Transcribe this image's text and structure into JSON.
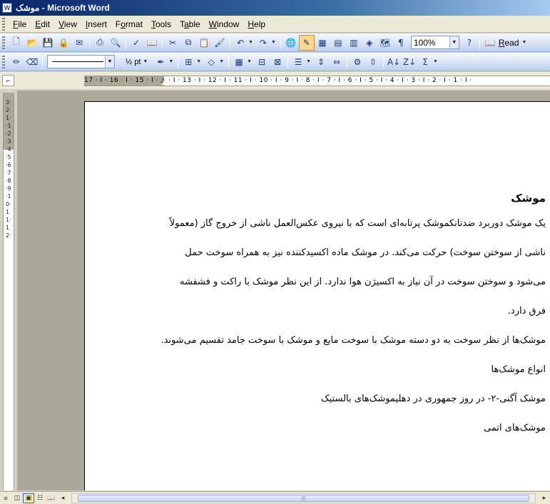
{
  "window": {
    "title": "موشک - Microsoft Word",
    "icon": "word-document-icon"
  },
  "menu": [
    {
      "id": "file",
      "label": "File",
      "underline": "F"
    },
    {
      "id": "edit",
      "label": "Edit",
      "underline": "E"
    },
    {
      "id": "view",
      "label": "View",
      "underline": "V"
    },
    {
      "id": "insert",
      "label": "Insert",
      "underline": "I"
    },
    {
      "id": "format",
      "label": "Format",
      "underline": "o"
    },
    {
      "id": "tools",
      "label": "Tools",
      "underline": "T"
    },
    {
      "id": "table",
      "label": "Table",
      "underline": "a"
    },
    {
      "id": "window",
      "label": "Window",
      "underline": "W"
    },
    {
      "id": "help",
      "label": "Help",
      "underline": "H"
    }
  ],
  "toolbar_standard": {
    "zoom": "100%",
    "read_label": "Read",
    "read_underline": "R"
  },
  "toolbar_drawing": {
    "line_weight": "½ pt"
  },
  "ruler": {
    "horizontal_numbers": "17 · I · 16 · I · 15 · I · △ · I · 13 · I · 12 · I · 11 · I · 10 · I · 9 · I · 8 · I · 7 · I · 6 · I · 5 · I · 4 · I · 3 · I · 2 · I · 1 · I ·",
    "vertical_numbers": "3·2·1··1·2·3·4·5·6·7·8·9·10·11·12·"
  },
  "document": {
    "heading": "موشک",
    "paragraphs": [
      "یک موشک دوربرد ضدتانکموشک پرتابه‌ای است که با نیروی عکس‌العمل ناشی از خروج گاز (معمولاً ناشی از سوختن سوخت) حرکت می‌کند. در موشک ماده اکسیدکننده نیز به همراه سوخت حمل می‌شود و سوختن سوخت در آن نیاز به اکسیژن هوا ندارد. از این نظر موشک با راکت و فشفشه فرق دارد.",
      "موشک‌ها از نظر سوخت به دو دسته موشک با سوخت مایع و موشک با سوخت جامد تقسیم می‌شوند.",
      "انواع موشک‌ها",
      "موشک آگنی-۲- در روز جمهوری در دهلیموشک‌های بالستیک",
      "موشک‌های اتمی"
    ]
  }
}
